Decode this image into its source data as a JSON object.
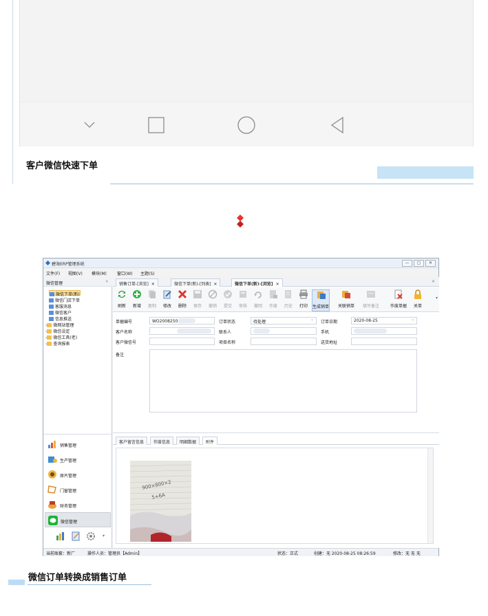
{
  "article": {
    "caption_top": "客户微信快速下单",
    "caption_bottom": "微信订单转换成销售订单"
  },
  "phone_nav": {
    "icons": [
      "chevron-down-icon",
      "square-home-icon",
      "circle-icon",
      "triangle-back-icon"
    ]
  },
  "erp": {
    "title": "碧海ERP管理系统",
    "window_buttons": [
      "—",
      "▢",
      "✕"
    ],
    "menu": [
      "文件(F)",
      "视图(V)",
      "模块(M)",
      "窗口(W)",
      "主题(S)"
    ],
    "sidebar": {
      "header": "微信管理",
      "collapse": "«",
      "tree": [
        {
          "label": "微信下单(新)",
          "selected": true
        },
        {
          "label": "微信门店下单"
        },
        {
          "label": "客服消息"
        },
        {
          "label": "微信客户"
        },
        {
          "label": "信息推送"
        },
        {
          "label": "微网站管理"
        },
        {
          "label": "微信设定"
        },
        {
          "label": "微信工具(老)"
        },
        {
          "label": "查询报表"
        }
      ],
      "modules": [
        "销售管理",
        "生产管理",
        "原片管理",
        "门窗管理",
        "财务管理",
        "微信管理"
      ]
    },
    "tabs": [
      {
        "label": "销售订单-[浏览]",
        "close": "✕"
      },
      {
        "label": "微信下单(新)-[列表]",
        "close": "✕"
      },
      {
        "label": "微信下单(新)-[浏览]",
        "close": "✕"
      }
    ],
    "panel_close": "×",
    "toolbar": [
      {
        "label": "刷新"
      },
      {
        "label": "新增"
      },
      {
        "label": "复制"
      },
      {
        "label": "修改"
      },
      {
        "label": "删除"
      },
      {
        "label": "保存"
      },
      {
        "label": "撤销"
      },
      {
        "label": "提交"
      },
      {
        "label": "审核"
      },
      {
        "label": "撤回"
      },
      {
        "label": "作废"
      },
      {
        "label": "历史"
      },
      {
        "label": "打印"
      },
      {
        "label": "生成销单"
      },
      {
        "label": "关联销单"
      },
      {
        "label": "填写备注"
      },
      {
        "label": "作废单据"
      },
      {
        "label": "关单"
      }
    ],
    "form": {
      "order_no_label": "单据编号",
      "order_no": "WO2008250",
      "status_label": "订单状态",
      "status": "待处理",
      "date_label": "订单日期",
      "date": "2020-08-25",
      "customer_label": "客户名称",
      "contact_label": "联系人",
      "phone_label": "手机",
      "wechat_label": "客户微信号",
      "project_label": "项目名称",
      "address_label": "送货地址",
      "remark_label": "备注"
    },
    "subtabs": [
      "客户留言信息",
      "作废信息",
      "明细数据",
      "附件"
    ],
    "photo_note": "900×800×2\n5+6A",
    "status": {
      "account": "当前账套：新厂",
      "operator": "操作人员：管理员【Admin】",
      "state": "状态：正式",
      "created": "创建：无 2020-08-25 08:26:59",
      "modified": "修改：无 无 无"
    }
  }
}
